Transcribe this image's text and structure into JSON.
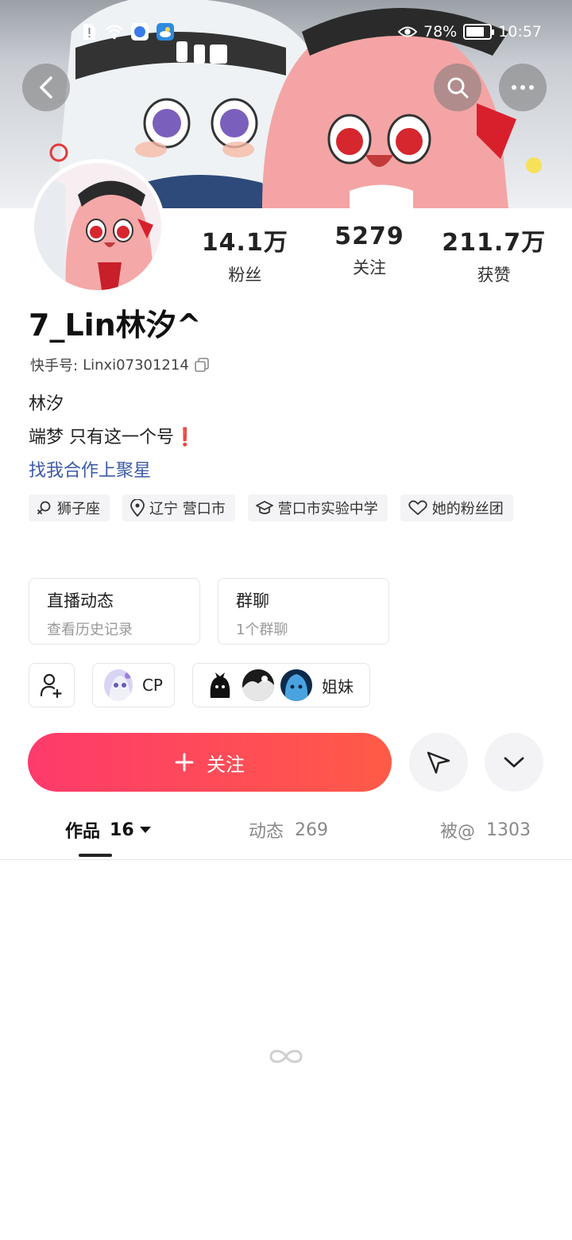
{
  "status_bar": {
    "battery_percent": "78%",
    "battery_level": 0.78,
    "time": "10:57",
    "icons": [
      "sim-alert-icon",
      "wifi-icon",
      "app-notification-icon",
      "weather-icon",
      "eye-comfort-icon"
    ]
  },
  "header_buttons": {
    "back": "back-arrow-icon",
    "search": "search-icon",
    "more": "more-dots-icon"
  },
  "profile": {
    "stats": [
      {
        "value": "14.1万",
        "label": "粉丝"
      },
      {
        "value": "5279",
        "label": "关注"
      },
      {
        "value": "211.7万",
        "label": "获赞"
      }
    ],
    "username": "7_Lin林汐^",
    "kid_label": "快手号:",
    "kid_value": "Linxi07301214",
    "bio_lines": [
      "林汐",
      "端梦  只有这一个号❗"
    ],
    "bio_link": "找我合作上聚星"
  },
  "tags": [
    {
      "icon": "female-icon",
      "text": "狮子座"
    },
    {
      "icon": "location-icon",
      "text": "辽宁 营口市"
    },
    {
      "icon": "school-icon",
      "text": "营口市实验中学"
    },
    {
      "icon": "fan-club-heart-icon",
      "text": "她的粉丝团"
    }
  ],
  "cards": [
    {
      "title": "直播动态",
      "subtitle": "查看历史记录"
    },
    {
      "title": "群聊",
      "subtitle": "1个群聊"
    }
  ],
  "relations": {
    "cp_label": "CP",
    "sisters_label": "姐妹"
  },
  "actions": {
    "follow_label": "关注",
    "follow_icon": "plus-icon",
    "share_icon": "paper-plane-icon",
    "expand_icon": "chevron-down-icon"
  },
  "tabs": [
    {
      "label": "作品",
      "count": "16",
      "active": true
    },
    {
      "label": "动态",
      "count": "269",
      "active": false
    },
    {
      "label": "被@",
      "count": "1303",
      "active": false
    }
  ],
  "colors": {
    "accent_start": "#fe3a6b",
    "accent_end": "#ff5b47",
    "link": "#3b5aa6"
  }
}
